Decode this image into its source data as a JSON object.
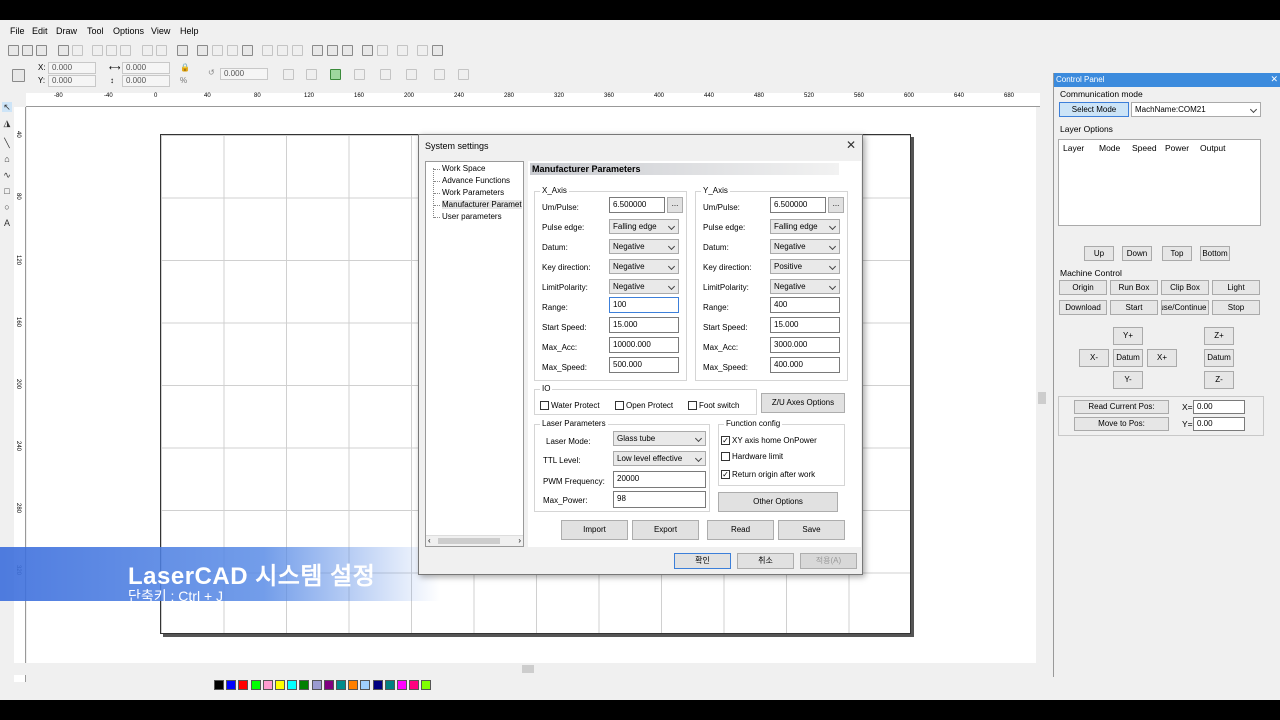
{
  "menu": [
    "File",
    "Edit",
    "Draw",
    "Tool",
    "Options",
    "View",
    "Help"
  ],
  "coords": {
    "x_label": "X:",
    "x_value": "0.000",
    "y_label": "Y:",
    "y_value": "0.000",
    "w_value": "0.000",
    "h_value": "0.000",
    "rot_value": "0.000",
    "pct_label": "%"
  },
  "ruler": {
    "h_ticks": [
      "-80",
      "-40",
      "0",
      "40",
      "80",
      "120",
      "160",
      "200",
      "240",
      "280",
      "320",
      "360",
      "400",
      "440",
      "480",
      "520",
      "560",
      "600",
      "640",
      "680"
    ],
    "v_ticks": [
      "40",
      "80",
      "120",
      "160",
      "200",
      "240",
      "280",
      "320"
    ]
  },
  "palette_colors": [
    "#000000",
    "#0000ff",
    "#ff0000",
    "#00ff00",
    "#ff9bd0",
    "#ffff00",
    "#00ffff",
    "#008000",
    "#9b9bd0",
    "#800080",
    "#008b8b",
    "#ff8000",
    "#9fd0ff",
    "#000080",
    "#008080",
    "#ff00ff",
    "#ff0080",
    "#80ff00"
  ],
  "dialog": {
    "title": "System settings",
    "tree": [
      "Work Space",
      "Advance Functions",
      "Work Parameters",
      "Manufacturer Paramet",
      "User parameters"
    ],
    "header": "Manufacturer Parameters",
    "x_axis": {
      "title": "X_Axis",
      "labels": [
        "Um/Pulse:",
        "Pulse edge:",
        "Datum:",
        "Key direction:",
        "LimitPolarity:",
        "Range:",
        "Start Speed:",
        "Max_Acc:",
        "Max_Speed:"
      ],
      "values": [
        "6.500000",
        "Falling edge",
        "Negative",
        "Negative",
        "Negative",
        "100",
        "15.000",
        "10000.000",
        "500.000"
      ]
    },
    "y_axis": {
      "title": "Y_Axis",
      "labels": [
        "Um/Pulse:",
        "Pulse edge:",
        "Datum:",
        "Key direction:",
        "LimitPolarity:",
        "Range:",
        "Start Speed:",
        "Max_Acc:",
        "Max_Speed:"
      ],
      "values": [
        "6.500000",
        "Falling edge",
        "Negative",
        "Positive",
        "Negative",
        "400",
        "15.000",
        "3000.000",
        "400.000"
      ]
    },
    "dots": "...",
    "io": {
      "title": "IO",
      "water": "Water Protect",
      "open": "Open Protect",
      "foot": "Foot switch",
      "zu_button": "Z/U Axes Options"
    },
    "laser": {
      "title": "Laser Parameters",
      "mode_label": "Laser Mode:",
      "mode_value": "Glass tube",
      "ttl_label": "TTL Level:",
      "ttl_value": "Low level effective",
      "pwm_label": "PWM Frequency:",
      "pwm_value": "20000",
      "power_label": "Max_Power:",
      "power_value": "98"
    },
    "func": {
      "title": "Function config",
      "home": "XY axis home OnPower",
      "hw": "Hardware limit",
      "ret": "Return origin after work",
      "other": "Other Options"
    },
    "actions": [
      "Import",
      "Export",
      "Read",
      "Save"
    ],
    "bottom": {
      "ok": "확인",
      "cancel": "취소",
      "apply": "적용(A)"
    }
  },
  "control_panel": {
    "title": "Control Panel",
    "comm_label": "Communication mode",
    "select_mode": "Select Mode",
    "mach_name": "MachName:COM21",
    "layer_label": "Layer Options",
    "layer_cols": [
      "Layer",
      "Mode",
      "Speed",
      "Power",
      "Output"
    ],
    "layer_buttons": [
      "Up",
      "Down",
      "Top",
      "Bottom"
    ],
    "machine_label": "Machine Control",
    "machine_row1": [
      "Origin",
      "Run Box",
      "Clip Box",
      "Light"
    ],
    "machine_row2": [
      "Download",
      "Start",
      "Pause/Continue",
      "Stop"
    ],
    "jog": {
      "yplus": "Y+",
      "yminus": "Y-",
      "xminus": "X-",
      "xplus": "X+",
      "datum": "Datum",
      "zplus": "Z+",
      "zminus": "Z-",
      "zdatum": "Datum"
    },
    "read_pos": "Read Current Pos:",
    "move_pos": "Move to Pos:",
    "x_label": "X=",
    "x_value": "0.00",
    "y_label": "Y=",
    "y_value": "0.00"
  },
  "caption": {
    "title": "LaserCAD 시스템 설정",
    "shortcut": "단축키 : Ctrl + J"
  }
}
